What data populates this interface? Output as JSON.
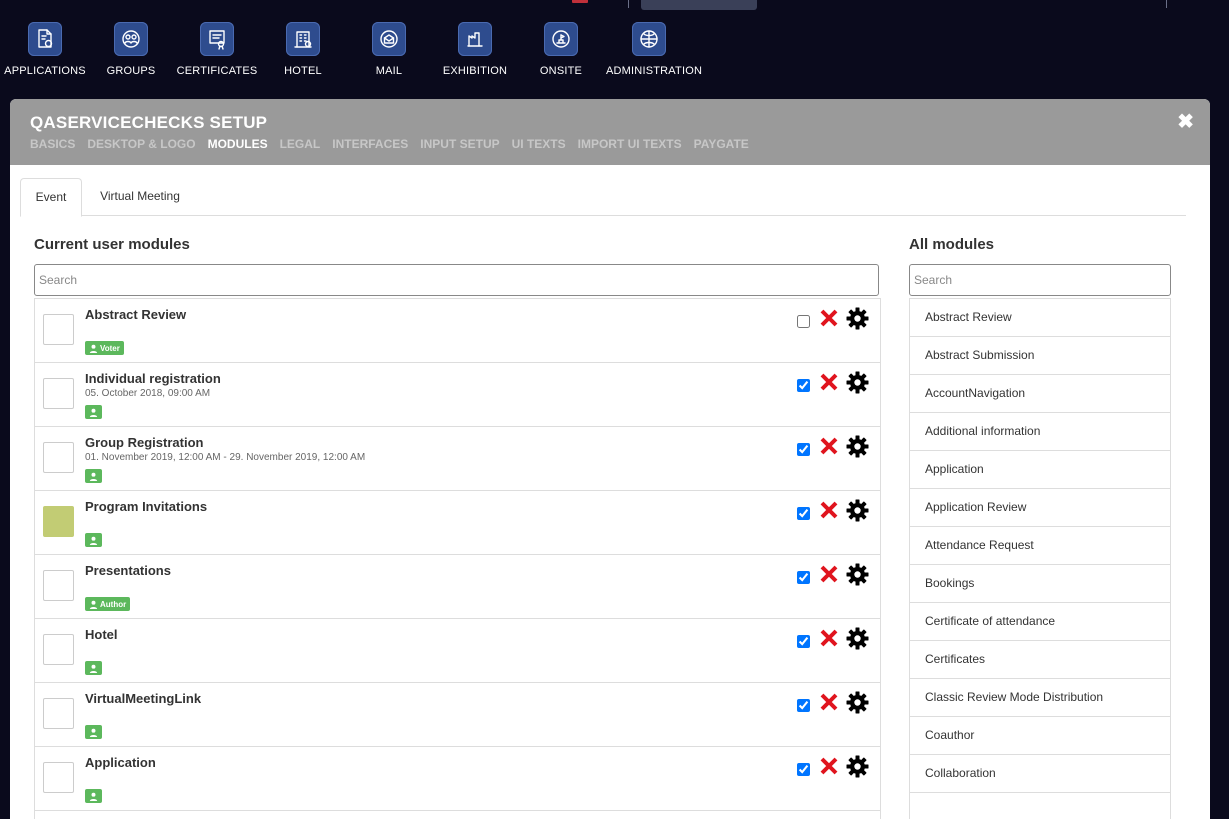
{
  "nav": {
    "items": [
      {
        "label": "APPLICATIONS",
        "icon": "applications-icon"
      },
      {
        "label": "GROUPS",
        "icon": "groups-icon"
      },
      {
        "label": "CERTIFICATES",
        "icon": "certificates-icon"
      },
      {
        "label": "HOTEL",
        "icon": "hotel-icon"
      },
      {
        "label": "MAIL",
        "icon": "mail-icon"
      },
      {
        "label": "EXHIBITION",
        "icon": "exhibition-icon"
      },
      {
        "label": "ONSITE",
        "icon": "onsite-icon"
      },
      {
        "label": "ADMINISTRATION",
        "icon": "administration-icon"
      }
    ]
  },
  "modal": {
    "title": "QASERVICECHECKS SETUP",
    "close_icon": "close-icon",
    "subtabs": [
      "BASICS",
      "DESKTOP & LOGO",
      "MODULES",
      "LEGAL",
      "INTERFACES",
      "INPUT SETUP",
      "UI TEXTS",
      "IMPORT UI TEXTS",
      "PAYGATE"
    ],
    "active_subtab": "MODULES"
  },
  "tabs": {
    "event": "Event",
    "virtual_meeting": "Virtual Meeting",
    "active": "Event"
  },
  "current": {
    "title": "Current user modules",
    "search_placeholder": "Search",
    "modules": [
      {
        "name": "Abstract Review",
        "date": "",
        "badge": "Voter",
        "checked": false,
        "thumb_color": "#ffffff"
      },
      {
        "name": "Individual registration",
        "date": "05. October 2018, 09:00 AM",
        "badge": "",
        "checked": true,
        "thumb_color": "#ffffff"
      },
      {
        "name": "Group Registration",
        "date": "01. November 2019, 12:00 AM - 29. November 2019, 12:00 AM",
        "badge": "",
        "checked": true,
        "thumb_color": "#ffffff"
      },
      {
        "name": "Program Invitations",
        "date": "",
        "badge": "",
        "checked": true,
        "thumb_color": "#c2cc74"
      },
      {
        "name": "Presentations",
        "date": "",
        "badge": "Author",
        "checked": true,
        "thumb_color": "#ffffff"
      },
      {
        "name": "Hotel",
        "date": "",
        "badge": "",
        "checked": true,
        "thumb_color": "#ffffff"
      },
      {
        "name": "VirtualMeetingLink",
        "date": "",
        "badge": "",
        "checked": true,
        "thumb_color": "#ffffff"
      },
      {
        "name": "Application",
        "date": "",
        "badge": "",
        "checked": true,
        "thumb_color": "#ffffff"
      }
    ]
  },
  "all": {
    "title": "All modules",
    "search_placeholder": "Search",
    "modules": [
      "Abstract Review",
      "Abstract Submission",
      "AccountNavigation",
      "Additional information",
      "Application",
      "Application Review",
      "Attendance Request",
      "Bookings",
      "Certificate of attendance",
      "Certificates",
      "Classic Review Mode Distribution",
      "Coauthor",
      "Collaboration"
    ]
  },
  "colors": {
    "badge": "#5cb85c",
    "delete": "#e0141e",
    "header_gray": "#9a9a9a",
    "nav_bg": "#0a0a1c",
    "nav_icon": "#2e4c8e"
  }
}
